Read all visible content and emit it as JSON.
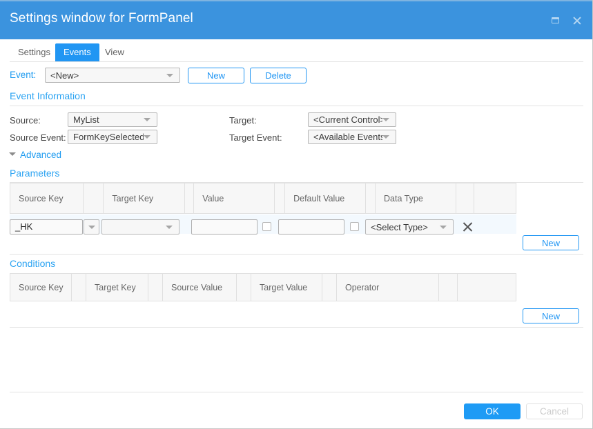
{
  "window": {
    "title": "Settings window for FormPanel",
    "controls": [
      {
        "name": "restore-button",
        "icon": "restore-icon"
      },
      {
        "name": "close-button",
        "icon": "close-icon"
      }
    ],
    "accent_color": "#3b93de",
    "tab_active_color": "#2196f3"
  },
  "tabs": [
    {
      "label": "Settings",
      "active": false
    },
    {
      "label": "Events",
      "active": true
    },
    {
      "label": "View",
      "active": false
    }
  ],
  "event_row": {
    "label": "Event:",
    "select_value": "<New>",
    "new_label": "New",
    "delete_label": "Delete"
  },
  "event_information": {
    "title": "Event Information",
    "source_label": "Source:",
    "source_value": "MyList",
    "source_event_label": "Source Event:",
    "source_event_value": "FormKeySelected",
    "target_label": "Target:",
    "target_value": "<Current Control>",
    "target_event_label": "Target Event:",
    "target_event_value": "<Available Events>",
    "advanced_label": "Advanced"
  },
  "parameters": {
    "title": "Parameters",
    "columns": [
      "Source Key",
      "",
      "Target Key",
      "",
      "Value",
      "",
      "Default Value",
      "",
      "Data Type",
      "",
      ""
    ],
    "rows": [
      {
        "source_key": "_HK",
        "target_key": "",
        "value": "",
        "value_checkbox": false,
        "default_value": "",
        "default_checkbox": false,
        "data_type": "<Select Type>",
        "delete_icon": "close-icon"
      }
    ],
    "new_label": "New"
  },
  "conditions": {
    "title": "Conditions",
    "columns": [
      "Source Key",
      "",
      "Target Key",
      "",
      "Source Value",
      "",
      "Target Value",
      "",
      "Operator",
      "",
      ""
    ],
    "rows": [],
    "new_label": "New"
  },
  "footer": {
    "ok_label": "OK",
    "cancel_label": "Cancel",
    "cancel_disabled": true
  }
}
